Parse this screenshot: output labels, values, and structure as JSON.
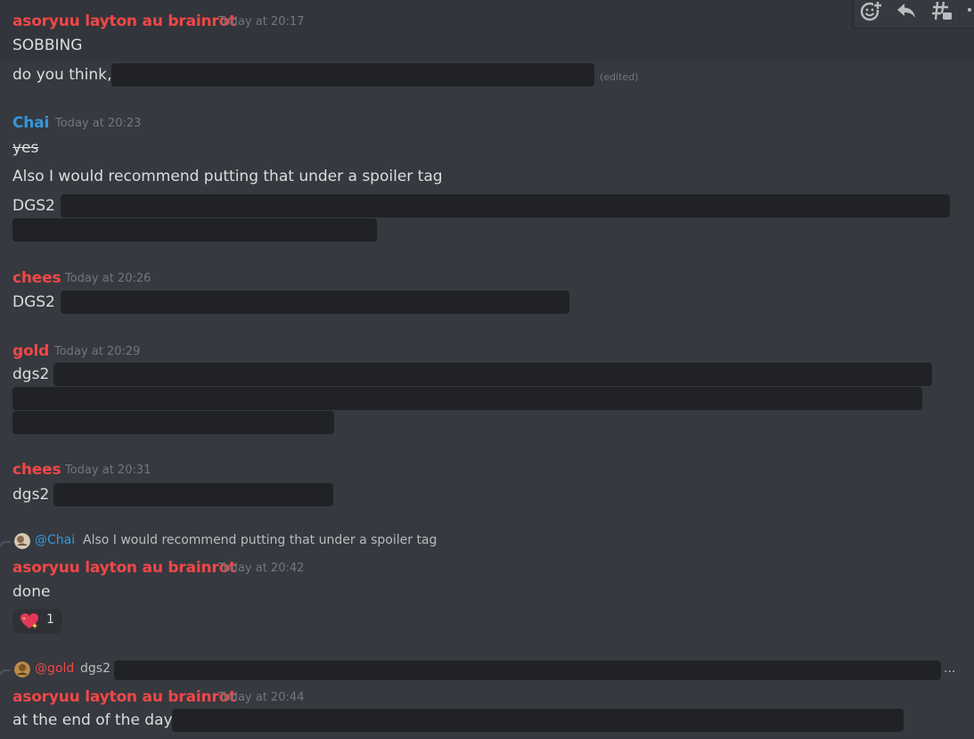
{
  "toolbar": {
    "icons": [
      "add-reaction-icon",
      "reply-icon",
      "create-thread-icon",
      "more-icon"
    ]
  },
  "messages": [
    {
      "author": "asoryuu layton au brainrot",
      "timestamp": "Today at 20:17",
      "lines": [
        "SOBBING",
        "do you think,"
      ],
      "edited": "(edited)"
    },
    {
      "author": "Chai",
      "timestamp": "Today at 20:23",
      "lines": [
        "yes",
        "Also I would recommend putting that under a spoiler tag",
        "DGS2"
      ]
    },
    {
      "author": "chees",
      "timestamp": "Today at 20:26",
      "lines": [
        "DGS2"
      ]
    },
    {
      "author": "gold",
      "timestamp": "Today at 20:29",
      "lines": [
        "dgs2"
      ]
    },
    {
      "author": "chees",
      "timestamp": "Today at 20:31",
      "lines": [
        "dgs2"
      ]
    },
    {
      "reply": {
        "mention": "@Chai",
        "text": "Also I would recommend putting that under a spoiler tag"
      },
      "author": "asoryuu layton au brainrot",
      "timestamp": "Today at 20:42",
      "lines": [
        "done"
      ],
      "reaction": {
        "emoji": "sparkling-heart-icon",
        "count": "1"
      }
    },
    {
      "reply": {
        "mention": "@gold",
        "text": "dgs2",
        "ellipsis": "..."
      },
      "author": "asoryuu layton au brainrot",
      "timestamp": "Today at 20:44",
      "lines": [
        "at the end of the day,"
      ]
    }
  ],
  "colors": {
    "background": "#36393f",
    "hover_background": "#32353b",
    "spoiler": "#202225",
    "author_red": "#f04747",
    "author_blue": "#3498db",
    "timestamp": "#72767d",
    "text": "#dcddde"
  }
}
